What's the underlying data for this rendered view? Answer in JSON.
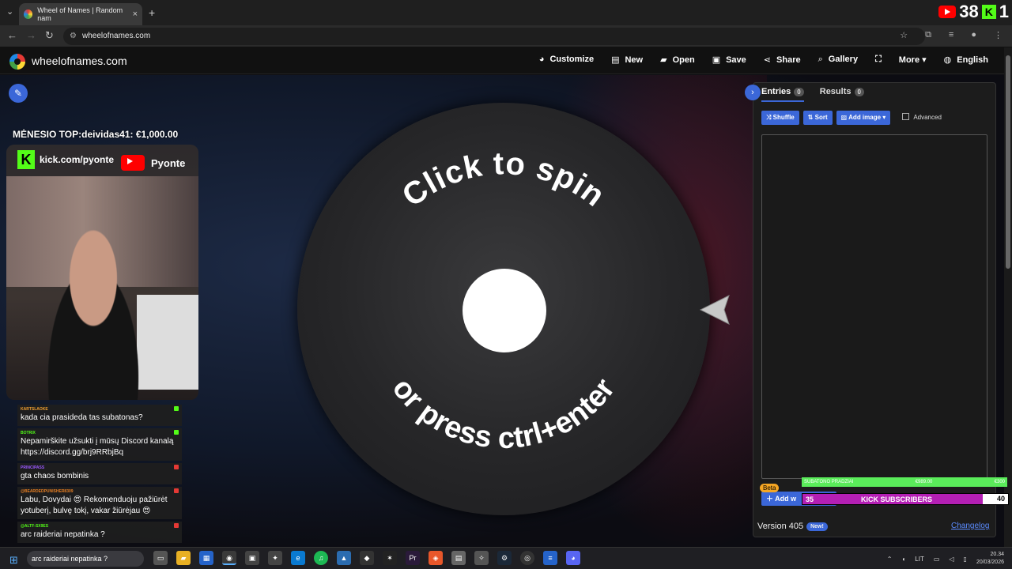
{
  "browser": {
    "tab_title": "Wheel of Names | Random nam",
    "tab_close": "×",
    "new_tab": "+",
    "url": "wheelofnames.com",
    "stream_counter": "38",
    "stream_counter2": "1"
  },
  "header": {
    "site_name": "wheelofnames.com",
    "menu": [
      "Customize",
      "New",
      "Open",
      "Save",
      "Share",
      "Gallery",
      "",
      "More",
      "English"
    ]
  },
  "wheel": {
    "line1": "Click to spin",
    "line2": "or press ctrl+enter"
  },
  "panel": {
    "tab_entries": "Entries",
    "tab_entries_count": "0",
    "tab_results": "Results",
    "tab_results_count": "0",
    "shuffle": "Shuffle",
    "sort": "Sort",
    "add_image": "Add image",
    "advanced": "Advanced",
    "beta": "Beta",
    "add_button": "Add w",
    "version": "Version 405",
    "new_badge": "New!",
    "changelog": "Changelog"
  },
  "overlay": {
    "top_line": "MĖNESIO TOP:deividas41: €1,000.00",
    "kick_url": "kick.com/pyonte",
    "yt_name": "Pyonte",
    "goal_bar_left": "SUBATONO PRADZIAI",
    "goal_bar_mid": "€989.00",
    "goal_bar_right": "€300",
    "subs_left": "35",
    "subs_label": "KICK SUBSCRIBERS",
    "subs_right": "40"
  },
  "chat": [
    {
      "user": "KARTSLAOKE",
      "color": "#f0a030",
      "text": "kada cia prasideda tas subatonas?",
      "badge": "#53fc18"
    },
    {
      "user": "BOTRIX",
      "color": "#53fc18",
      "text": "Nepamirškite užsukti į mūsų Discord kanalą https://discord.gg/brj9RRbjBq",
      "badge": "#53fc18"
    },
    {
      "user": "PRINCIPASS",
      "color": "#9b59ff",
      "text": "gta chaos bombinis",
      "badge": "#e53935"
    },
    {
      "user": "@BEARDEDPUNISHER8309",
      "color": "#e67e22",
      "text": "Labu, Dovydai 😍 Rekomenduoju pažiūrėt yotuberį, bulvę tokį, vakar žiūrėjau 😍",
      "badge": "#e53935"
    },
    {
      "user": "@ALTF-SX9ES",
      "color": "#53fc18",
      "text": "arc raideriai nepatinka ?",
      "badge": "#e53935"
    }
  ],
  "taskbar": {
    "search": "arc raideriai nepatinka ?",
    "lang": "LIT",
    "time": "20.34",
    "date": "20/03/2026"
  },
  "colors": {
    "accent": "#3b67d8",
    "kick": "#53fc18",
    "youtube": "#ff0000"
  }
}
